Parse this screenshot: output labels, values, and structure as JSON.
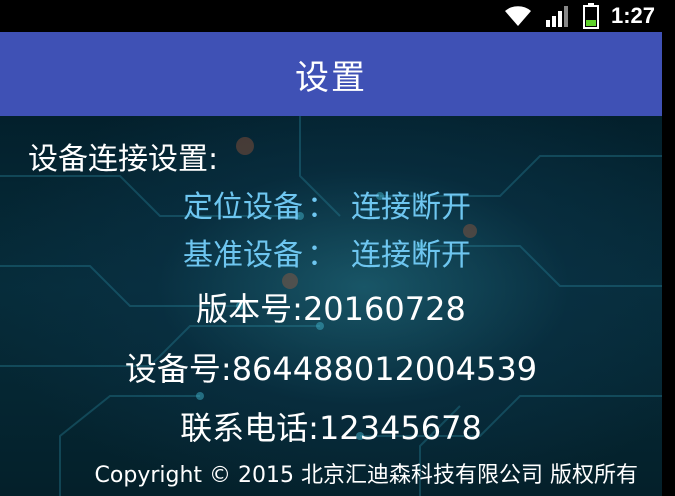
{
  "status_bar": {
    "time": "1:27",
    "icons": [
      "wifi-icon",
      "signal-icon",
      "battery-icon"
    ]
  },
  "header": {
    "title": "设置"
  },
  "main": {
    "heading": "设备连接设置:",
    "positioning_device": {
      "label": "定位设备",
      "separator": "：",
      "value": "连接断开"
    },
    "reference_device": {
      "label": "基准设备",
      "separator": "：",
      "value": "连接断开"
    },
    "version": "版本号:20160728",
    "device_number": "设备号:864488012004539",
    "phone": "联系电话:12345678"
  },
  "footer": {
    "copyright": "Copyright © 2015 北京汇迪森科技有限公司 版权所有"
  },
  "colors": {
    "title_bar": "#3f51b5",
    "status_text": "#6ec6f0",
    "text": "#ffffff"
  }
}
